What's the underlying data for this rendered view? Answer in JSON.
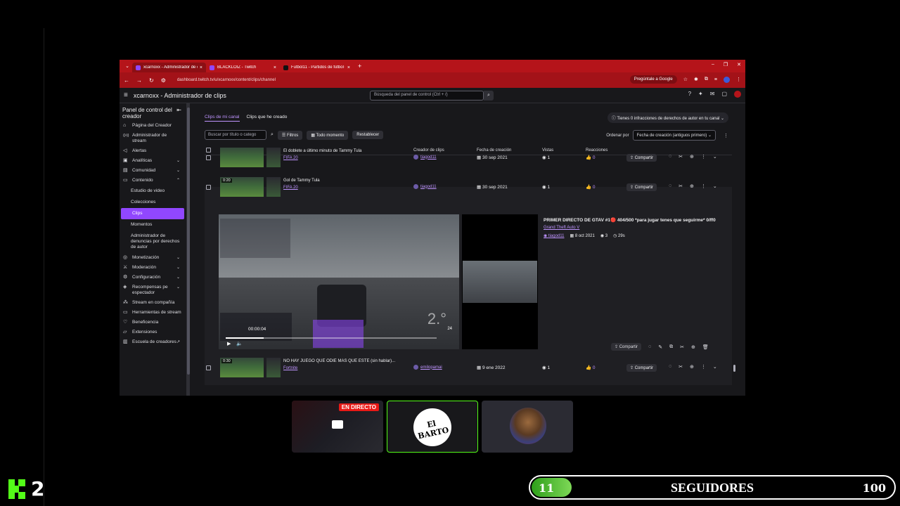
{
  "browser": {
    "tabs": [
      {
        "title": "xcarnoxx - Administrador de cl",
        "fav_color": "#9147ff",
        "active": true
      },
      {
        "title": "BLACKLOIZ - Twitch",
        "fav_color": "#9147ff",
        "active": false
      },
      {
        "title": "Futbol11 - Partidos de fútbol d",
        "fav_color": "#111111",
        "active": false
      }
    ],
    "url": "dashboard.twitch.tv/u/xcarnoxx/content/clips/channel",
    "ask_google": "Pregúntale a Google"
  },
  "header": {
    "title": "xcarnoxx - Administrador de clips",
    "search_placeholder": "Búsqueda del panel de control (Ctrl + /)"
  },
  "sidebar": {
    "title": "Panel de control del creador",
    "items": [
      {
        "label": "Página del Creador",
        "icon": "home-icon"
      },
      {
        "label": "Administrador de stream",
        "icon": "broadcast-icon"
      },
      {
        "label": "Alertas",
        "icon": "megaphone-icon"
      },
      {
        "label": "Analíticas",
        "icon": "chart-icon",
        "chev": "⌄"
      },
      {
        "label": "Comunidad",
        "icon": "community-icon",
        "chev": "⌄"
      },
      {
        "label": "Contenido",
        "icon": "content-icon",
        "chev": "⌃"
      }
    ],
    "content_sub": [
      "Estudio de video",
      "Colecciones",
      "Clips",
      "Momentos",
      "Administrador de denuncias por derechos de autor"
    ],
    "items2": [
      {
        "label": "Monetización",
        "icon": "money-icon",
        "chev": "⌄"
      },
      {
        "label": "Moderación",
        "icon": "sword-icon",
        "chev": "⌄"
      },
      {
        "label": "Configuración",
        "icon": "gear-icon",
        "chev": "⌄"
      },
      {
        "label": "Recompensas pe espectador",
        "icon": "reward-icon",
        "chev": "⌄"
      },
      {
        "label": "Stream en compañía",
        "icon": "together-icon"
      },
      {
        "label": "Herramientas de stream",
        "icon": "camera-icon"
      },
      {
        "label": "Beneficencia",
        "icon": "heart-icon"
      },
      {
        "label": "Extensiones",
        "icon": "puzzle-icon"
      },
      {
        "label": "Escuela de creadores",
        "icon": "book-icon",
        "chev": "↗"
      }
    ]
  },
  "main": {
    "tabs": [
      "Clips de mi canal",
      "Clips que he creado"
    ],
    "copyright": "Tienes 0 infracciones de derechos de autor en tu canal",
    "filter_placeholder": "Buscar por título o catego",
    "filters": [
      "Filtros",
      "Todo momento",
      "Restablecer"
    ],
    "sort_label": "Ordenar por",
    "sort_value": "Fecha de creación (antiguos primero)",
    "columns": [
      "Creador de clips",
      "Fecha de creación",
      "Vistas",
      "Reacciones"
    ],
    "rows": [
      {
        "title": "El doblete a último minuto de Tammy Tula",
        "game": "FIFA 20",
        "duration": "",
        "creator": "tiagod11",
        "date": "30 sep 2021",
        "views": "1",
        "reactions": "0"
      },
      {
        "title": "Gol de Tammy Tula",
        "game": "FIFA 20",
        "duration": "0:20",
        "creator": "tiagod11",
        "date": "30 sep 2021",
        "views": "1",
        "reactions": "0"
      },
      {
        "title": "NO HAY JUEGO QUE ODIE MAS QUE ESTE (sin hablar)...",
        "game": "Fortnite",
        "duration": "0:30",
        "creator": "emilopamai",
        "date": "9 ene 2022",
        "views": "1",
        "reactions": "0"
      }
    ],
    "share_label": "Compartir",
    "expanded": {
      "title": "PRIMER DIRECTO DE GTAV #1🔴 404/500 *para jugar tenes que seguirme* 0/ff0",
      "game": "Grand Theft Auto V",
      "creator": "tiagod11",
      "date": "8 oct 2021",
      "views": "3",
      "duration": "29s",
      "player_time": "00:00:04",
      "player_pos": "2.°",
      "player_num": "24",
      "progress": 0.18
    }
  },
  "overlay": {
    "live_badge": "EN DIRECTO",
    "logo_text": "El BARTO",
    "kick_number": "2",
    "followers_current": "11",
    "followers_label": "SEGUIDORES",
    "followers_goal": "100",
    "followers_fraction": 0.11,
    "accent": "#53fc18"
  }
}
